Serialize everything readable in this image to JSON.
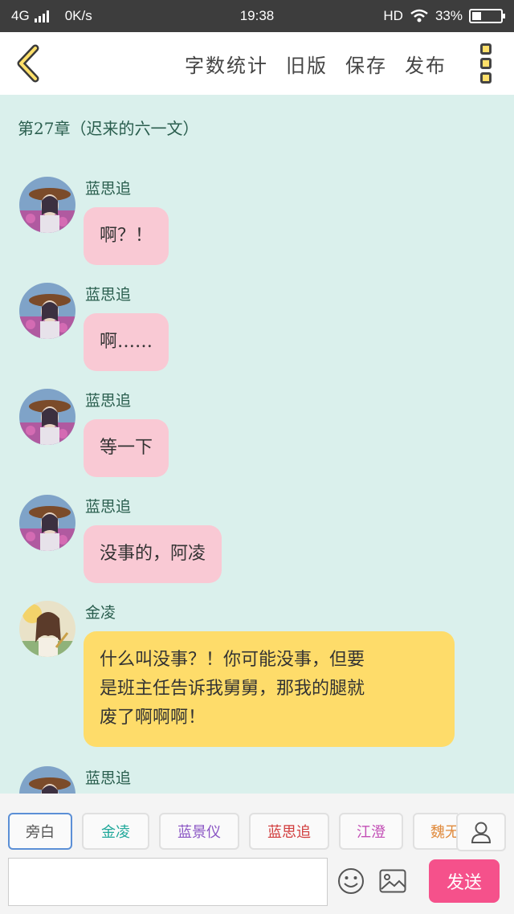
{
  "status_bar": {
    "network": "4G",
    "speed": "0K/s",
    "time": "19:38",
    "hd": "HD",
    "battery": "33%"
  },
  "header": {
    "back_icon": "chevron-left-icon",
    "actions": [
      "字数统计",
      "旧版",
      "保存",
      "发布"
    ],
    "more_icon": "more-vertical-icon"
  },
  "chapter_title": "第27章（迟来的六一文）",
  "messages": [
    {
      "name": "蓝思追",
      "text": "啊？！",
      "color": "#f9c9d4"
    },
    {
      "name": "蓝思追",
      "text": "啊……",
      "color": "#f9c9d4"
    },
    {
      "name": "蓝思追",
      "text": "等一下",
      "color": "#f9c9d4"
    },
    {
      "name": "蓝思追",
      "text": "没事的，阿凌",
      "color": "#f9c9d4"
    },
    {
      "name": "金凌",
      "text": "什么叫没事？！你可能没事，但要是班主任告诉我舅舅，那我的腿就废了啊啊啊！",
      "lines": [
        "什么叫没事？！你可能没事，但要",
        "是班主任告诉我舅舅，那我的腿就",
        "废了啊啊啊！"
      ],
      "color": "#fedc6a"
    },
    {
      "name": "蓝思追",
      "text": "",
      "color": "#f9c9d4"
    }
  ],
  "roles": [
    {
      "label": "旁白",
      "color": "#555555"
    },
    {
      "label": "金凌",
      "color": "#1fa89a"
    },
    {
      "label": "蓝景仪",
      "color": "#8a55c4"
    },
    {
      "label": "蓝思追",
      "color": "#d13c3c"
    },
    {
      "label": "江澄",
      "color": "#c34fb6"
    },
    {
      "label": "魏无",
      "color": "#e08a3c"
    }
  ],
  "input": {
    "placeholder": "",
    "value": ""
  },
  "send_label": "发送",
  "icons": {
    "person": "person-icon",
    "emoji": "smiley-icon",
    "image": "image-icon"
  }
}
